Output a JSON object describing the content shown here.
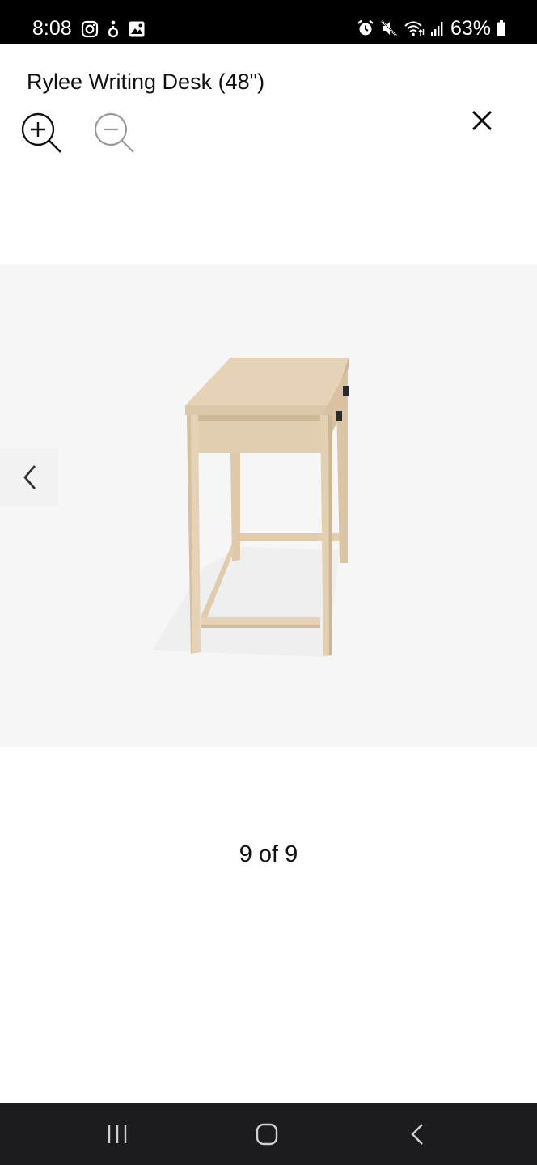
{
  "status_bar": {
    "time": "8:08",
    "battery_percent": "63%",
    "left_icons": [
      "instagram-icon",
      "accessibility-icon",
      "gallery-icon"
    ],
    "right_icons": [
      "alarm-icon",
      "mute-icon",
      "wifi-icon",
      "signal-icon",
      "battery-icon"
    ]
  },
  "header": {
    "title": "Rylee Writing Desk (48\")",
    "zoom_in_icon": "zoom-in-icon",
    "zoom_out_icon": "zoom-out-icon",
    "close_icon": "close-icon",
    "zoom_out_enabled": false
  },
  "gallery": {
    "counter": "9 of 9",
    "current_index": 9,
    "total": 9,
    "prev_icon": "chevron-left-icon",
    "image_subject": "light wood writing desk side view"
  },
  "nav_bar": {
    "buttons": [
      "recent-apps-icon",
      "home-icon",
      "back-icon"
    ]
  },
  "colors": {
    "status_bar": "#000000",
    "nav_bar": "#1c1c1e",
    "image_background": "#f6f6f6",
    "wood": "#e6d2b6",
    "disabled_icon": "#9a9a9a"
  }
}
